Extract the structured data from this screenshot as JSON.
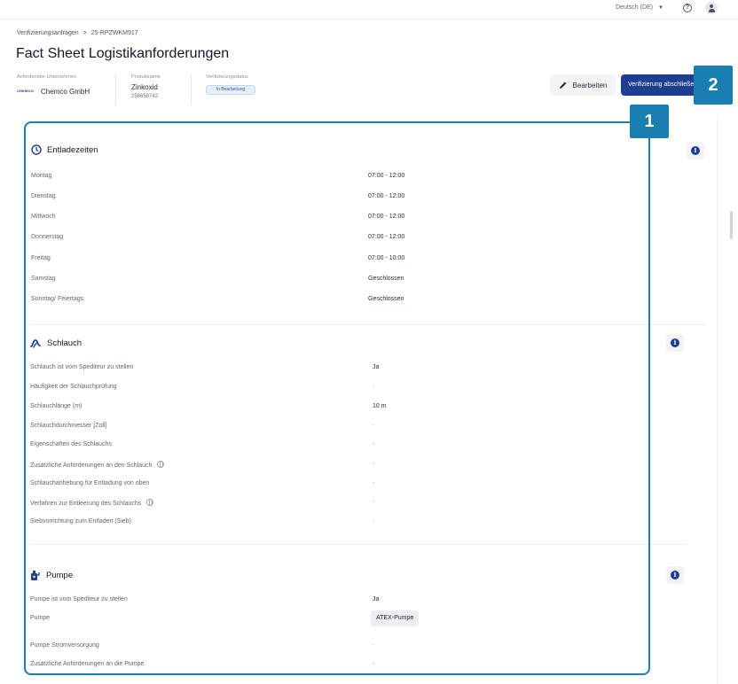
{
  "topbar": {
    "language": "Deutsch (DE)",
    "help_icon": "help-circle-icon",
    "user_icon": "user-avatar-icon"
  },
  "breadcrumb": {
    "parent": "Verifizierungsanfragen",
    "separator": ">",
    "current": "25-RPZWKM917"
  },
  "page": {
    "title": "Fact Sheet Logistikanforderungen"
  },
  "meta": {
    "company_label": "Anfordernder Unternehmen",
    "company_logo": "CHEMCO",
    "company_name": "Chemco GmbH",
    "product_label": "Produktname",
    "product_name": "Zinkoxid",
    "product_number": "258658742",
    "status_label": "Verifizierungsstatus",
    "status_value": "In Bearbeitung"
  },
  "actions": {
    "edit_label": "Bearbeiten",
    "verify_label": "Verifizierung abschließen"
  },
  "callouts": {
    "one": "1",
    "two": "2"
  },
  "sections": {
    "unloading": {
      "title": "Entladezeiten",
      "rows": [
        {
          "label": "Montag",
          "value": "07:00 - 12:00"
        },
        {
          "label": "Dienstag",
          "value": "07:00 - 12:00"
        },
        {
          "label": "Mittwoch",
          "value": "07:00 - 12:00"
        },
        {
          "label": "Donnerstag",
          "value": "07:00 - 12:00"
        },
        {
          "label": "Freitag",
          "value": "07:00 - 10:00"
        },
        {
          "label": "Samstag",
          "value": "Geschlossen"
        },
        {
          "label": "Sonntag/ Feiertags",
          "value": "Geschlossen"
        }
      ]
    },
    "hose": {
      "title": "Schlauch",
      "rows": [
        {
          "label": "Schlauch ist vom Spediteur zu stellen",
          "value": "Ja"
        },
        {
          "label": "Häufigkeit der Schlauchprüfung",
          "value": "-"
        },
        {
          "label": "Schlauchlänge (m)",
          "value": "10 m"
        },
        {
          "label": "Schlauchdurchmesser [Zoll]",
          "value": "-"
        },
        {
          "label": "Eigenschaften des Schlauchs",
          "value": "-"
        },
        {
          "label": "Zusätzliche Anforderungen an den Schlauch",
          "value": "-"
        },
        {
          "label": "Schlauchanhebung für Entladung von oben",
          "value": "-"
        },
        {
          "label": "Verfahren zur Entleerung des Schlauchs",
          "value": "-"
        },
        {
          "label": "Siebvorrichtung zum Entladen (Sieb)",
          "value": "-"
        }
      ]
    },
    "pump": {
      "title": "Pumpe",
      "rows": [
        {
          "label": "Pumpe ist vom Spediteur zu stellen",
          "value": "Ja"
        },
        {
          "label": "Pumpe",
          "value": "ATEX-Pumpe"
        },
        {
          "label": "Pumpe Stromversorgung",
          "value": "-"
        },
        {
          "label": "Zusätzliche Anforderungen an die Pumpe",
          "value": "-"
        }
      ]
    }
  }
}
